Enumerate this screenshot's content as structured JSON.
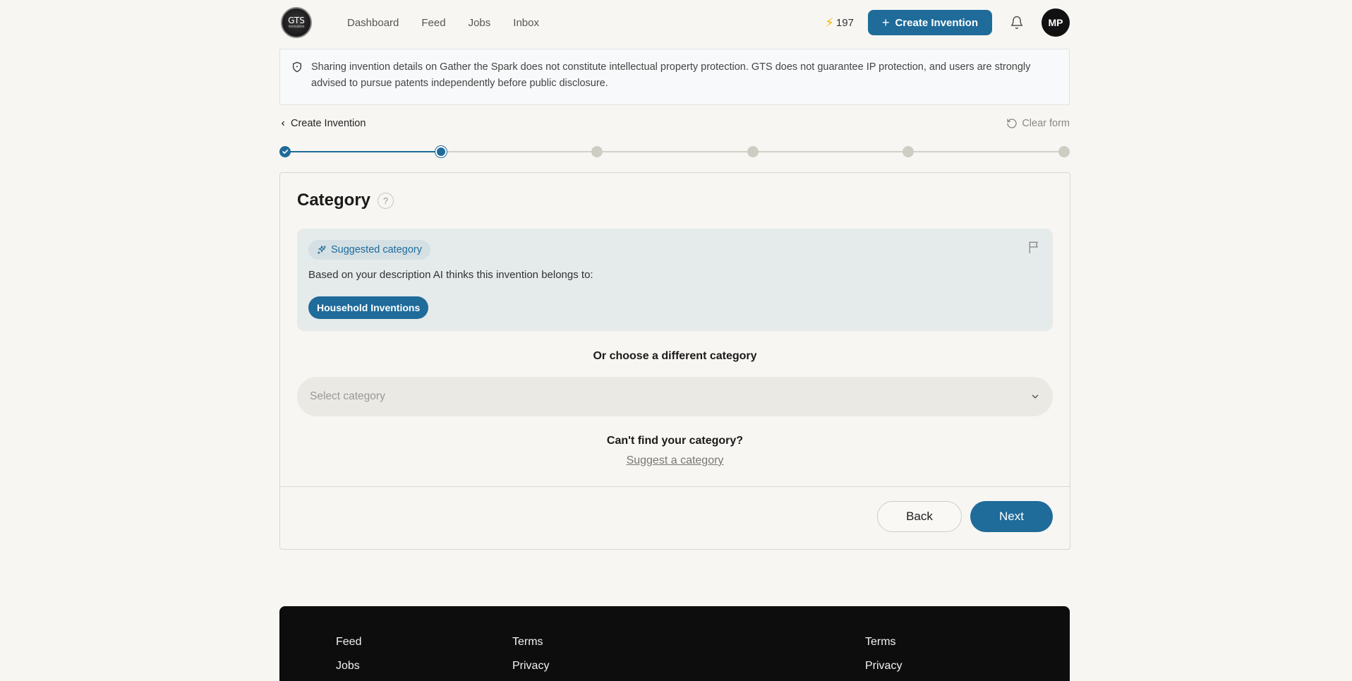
{
  "header": {
    "logo_text": "GTS",
    "logo_subtext": "innovation",
    "nav": [
      "Dashboard",
      "Feed",
      "Jobs",
      "Inbox"
    ],
    "points": "197",
    "create_button": "Create Invention",
    "avatar_initials": "MP"
  },
  "notice": {
    "text": "Sharing invention details on Gather the Spark does not constitute intellectual property protection. GTS does not guarantee IP protection, and users are strongly advised to pursue patents independently before public disclosure."
  },
  "breadcrumb": {
    "label": "Create Invention",
    "clear_label": "Clear form"
  },
  "stepper": {
    "total_steps": 6,
    "current_step": 2
  },
  "card": {
    "title": "Category",
    "help_glyph": "?",
    "suggested_badge": "Suggested category",
    "suggested_text": "Based on your description AI thinks this invention belongs to:",
    "suggested_category": "Household Inventions",
    "or_choose": "Or choose a different category",
    "select_placeholder": "Select category",
    "cant_find": "Can't find your category?",
    "suggest_link": "Suggest a category",
    "back_label": "Back",
    "next_label": "Next"
  },
  "footer": {
    "col1": [
      "Feed",
      "Jobs"
    ],
    "col2": [
      "Terms",
      "Privacy"
    ],
    "col3": [
      "Terms",
      "Privacy"
    ]
  },
  "colors": {
    "accent": "#1f6b9a",
    "background": "#f7f6f2",
    "footer": "#0d0d0d"
  }
}
